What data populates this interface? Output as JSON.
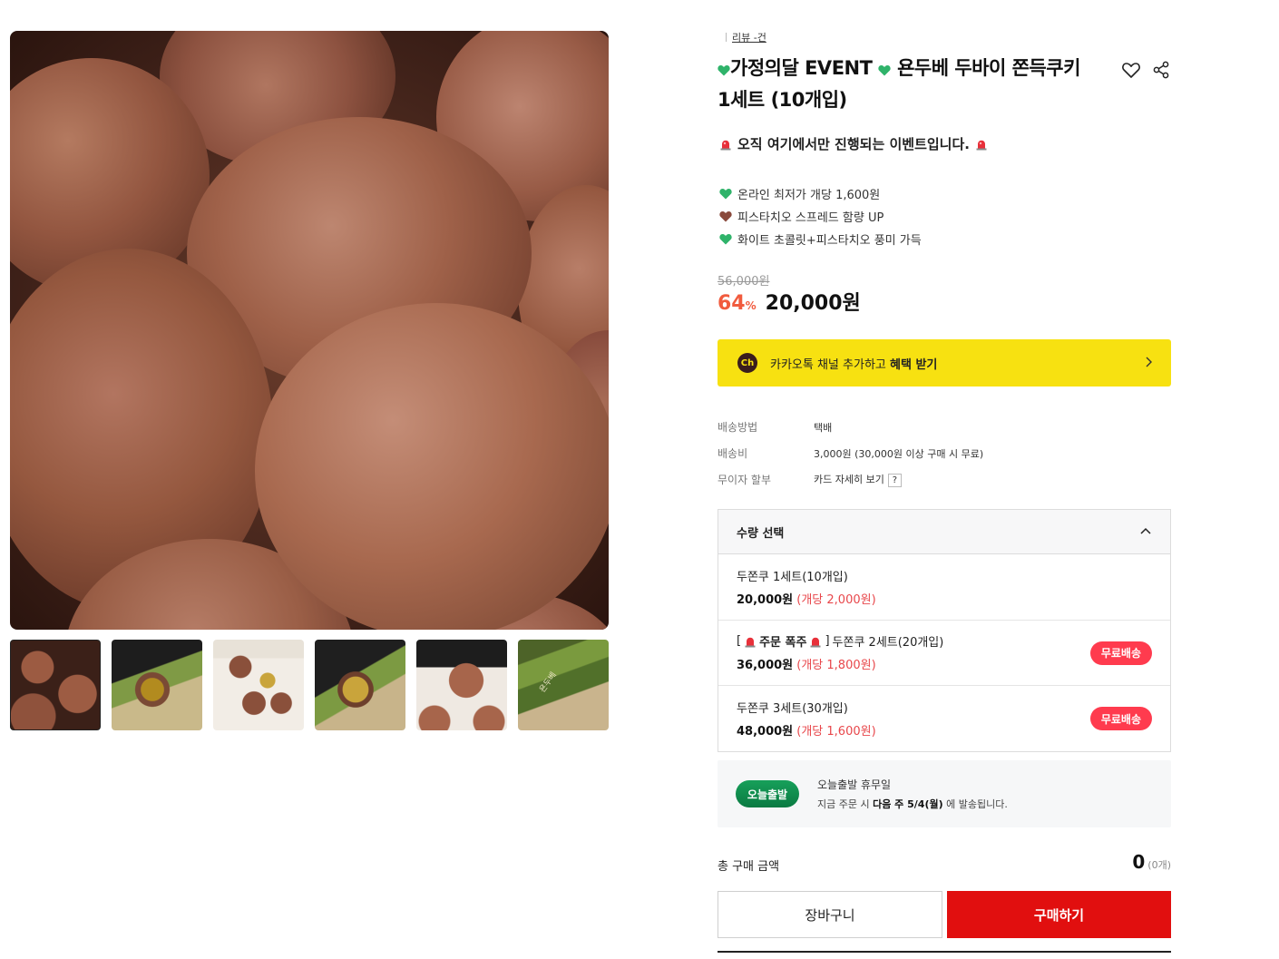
{
  "review": {
    "label": "리뷰 -건"
  },
  "product": {
    "title_line1": "가정의달 EVENT",
    "title_line1b": "욘두베 두바이 쫀득쿠키",
    "title_line2": "1세트 (10개입)",
    "event_text": "오직 여기에서만 진행되는 이벤트입니다.",
    "bullets": [
      {
        "text": "온라인 최저가 개당 1,600원",
        "icon": "green-heart-icon",
        "color": "#2fb36a"
      },
      {
        "text": "피스타치오 스프레드 함량 UP",
        "icon": "brown-heart-icon",
        "color": "#8a4a3c"
      },
      {
        "text": "화이트 초콜릿+피스타치오 풍미 가득",
        "icon": "green-heart-icon",
        "color": "#2fb36a"
      }
    ],
    "original_price": "56,000원",
    "discount": "64",
    "discount_unit": "%",
    "sale_price": "20,000원"
  },
  "kakao": {
    "icon_text": "Ch",
    "text": "카카오톡 채널 추가하고 ",
    "strong": "혜택 받기"
  },
  "info": [
    {
      "label": "배송방법",
      "value": "택배"
    },
    {
      "label": "배송비",
      "value": "3,000원 (30,000원 이상 구매 시 무료)"
    },
    {
      "label": "무이자 할부",
      "value": "카드 자세히 보기",
      "badge": "?"
    }
  ],
  "options": {
    "header": "수량 선택",
    "items": [
      {
        "name": "두쫀쿠 1세트(10개입)",
        "price": "20,000원",
        "unit": " (개당 2,000원)",
        "badge": ""
      },
      {
        "prefix_open": "[",
        "prefix_strong": "주문 폭주",
        "prefix_close": "]",
        "name": "두쫀쿠 2세트(20개입)",
        "price": "36,000원",
        "unit": " (개당 1,800원)",
        "badge": "무료배송"
      },
      {
        "name": "두쫀쿠 3세트(30개입)",
        "price": "48,000원",
        "unit": " (개당 1,600원)",
        "badge": "무료배송"
      }
    ]
  },
  "shipping": {
    "badge": "오늘출발",
    "title": "오늘출발 휴무일",
    "desc_pre": "지금 주문 시 ",
    "desc_strong": "다음 주 5/4(월)",
    "desc_post": " 에 발송됩니다."
  },
  "total": {
    "label": "총 구매 금액",
    "value": "0",
    "count": "(0개)"
  },
  "buttons": {
    "cart": "장바구니",
    "buy": "구매하기"
  },
  "thumbnails": [
    {
      "name": "thumb-1"
    },
    {
      "name": "thumb-2"
    },
    {
      "name": "thumb-3"
    },
    {
      "name": "thumb-4"
    },
    {
      "name": "thumb-5"
    },
    {
      "name": "thumb-6",
      "label": "욘두베"
    }
  ],
  "colors": {
    "accent_red": "#e10f0f",
    "discount": "#f15b3e",
    "kakao_yellow": "#f7e111",
    "free_badge": "#ff3b4e",
    "ship_green": "#17a05a"
  }
}
